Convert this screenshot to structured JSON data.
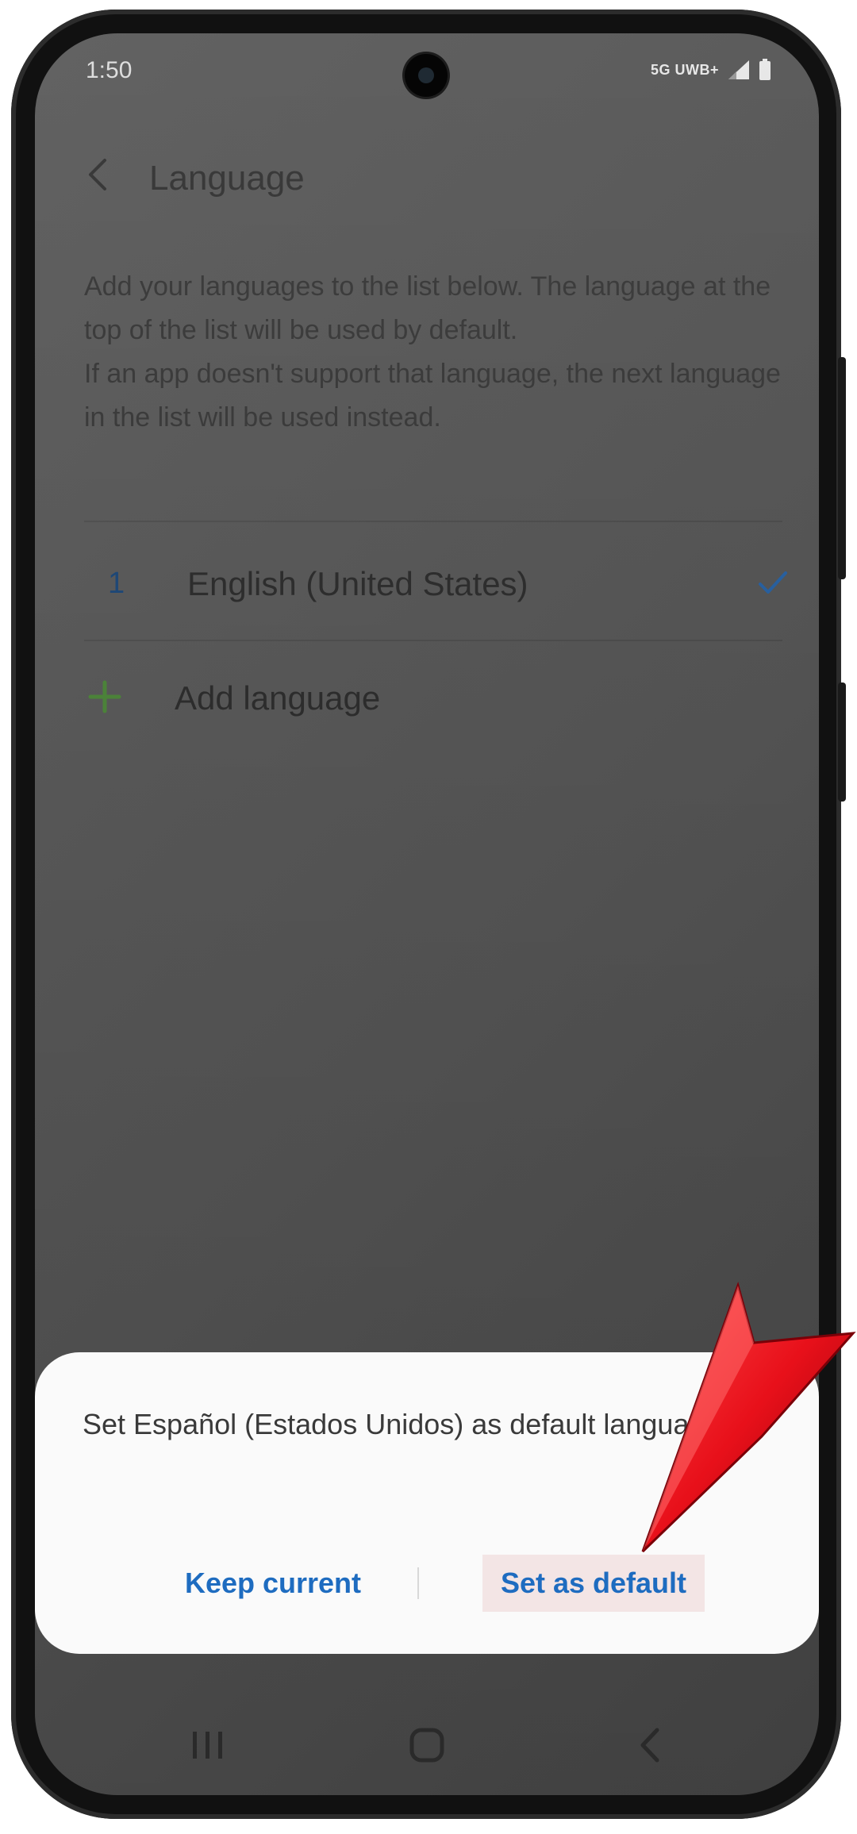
{
  "status_bar": {
    "time": "1:50",
    "network": "5G UWB",
    "network_suffix": "+",
    "icons": [
      "signal-icon",
      "battery-icon"
    ]
  },
  "header": {
    "title": "Language",
    "back_icon": "chevron-left-icon"
  },
  "description": {
    "paragraph_1": "Add your languages to the list below. The language at the top of the list will be used by default.",
    "paragraph_2": "If an app doesn't support that language, the next language in the list will be used instead."
  },
  "languages": [
    {
      "index": "1",
      "name": "English (United States)",
      "selected_icon": "check-icon"
    }
  ],
  "add_language": {
    "label": "Add language",
    "icon": "plus-icon"
  },
  "dialog": {
    "message": "Set Español (Estados Unidos) as default language?",
    "keep_label": "Keep current",
    "set_label": "Set as default"
  },
  "nav_bar": {
    "icons": [
      "recents-icon",
      "home-icon",
      "back-icon"
    ]
  },
  "colors": {
    "accent": "#1e6cc0",
    "check": "#2a64a6",
    "plus": "#4f8a3c",
    "annotation": "#e8101a",
    "dim_overlay": "#575757",
    "dialog_bg": "#fafafa"
  }
}
